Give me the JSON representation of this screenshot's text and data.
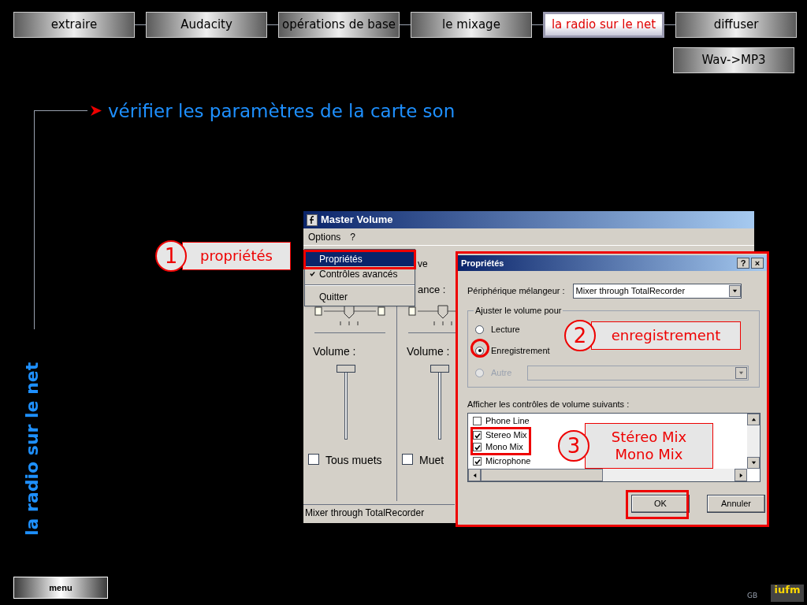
{
  "nav": {
    "tabs": [
      {
        "label": "extraire",
        "selected": false
      },
      {
        "label": "Audacity",
        "selected": false
      },
      {
        "label": "opérations de base",
        "selected": false
      },
      {
        "label": "le mixage",
        "selected": false
      },
      {
        "label": "la radio sur le net",
        "selected": true
      },
      {
        "label": "diffuser",
        "selected": false
      }
    ],
    "sub_tab": "Wav->MP3"
  },
  "heading": "vérifier les paramètres de la carte son",
  "side_title": "la radio sur le net",
  "master_volume": {
    "title": "Master Volume",
    "menu": [
      "Options",
      "?"
    ],
    "dropdown": [
      {
        "kind": "item",
        "label": "Propriétés",
        "selected": true,
        "checked": false
      },
      {
        "kind": "item",
        "label": "Contrôles avancés",
        "selected": false,
        "checked": true
      },
      {
        "kind": "separator"
      },
      {
        "kind": "item",
        "label": "Quitter",
        "selected": false,
        "checked": false
      }
    ],
    "hidden_labels": [
      "ve",
      "ance :"
    ],
    "columns": [
      {
        "label": "Volume :",
        "level": 1,
        "mute_label": "Tous muets",
        "muted": false
      },
      {
        "label": "Volume :",
        "level": 1,
        "mute_label": "Muet",
        "muted": false
      }
    ],
    "status": "Mixer through TotalRecorder"
  },
  "properties": {
    "title": "Propriétés",
    "title_buttons": [
      "?",
      "×"
    ],
    "mixer_label": "Périphérique mélangeur :",
    "mixer_value": "Mixer through TotalRecorder",
    "group_label": "Ajuster le volume pour",
    "radios": [
      {
        "label": "Lecture",
        "selected": false,
        "disabled": false
      },
      {
        "label": "Enregistrement",
        "selected": true,
        "disabled": false
      },
      {
        "label": "Autre",
        "selected": false,
        "disabled": true
      }
    ],
    "list_label": "Afficher les contrôles de volume suivants :",
    "list_items": [
      {
        "label": "Phone Line",
        "checked": false
      },
      {
        "label": "Stereo Mix",
        "checked": true
      },
      {
        "label": "Mono Mix",
        "checked": true
      },
      {
        "label": "Microphone",
        "checked": true
      }
    ],
    "buttons": [
      "OK",
      "Annuler"
    ]
  },
  "callouts": [
    {
      "number": "1",
      "lines": [
        "propriétés"
      ]
    },
    {
      "number": "2",
      "lines": [
        "enregistrement"
      ]
    },
    {
      "number": "3",
      "lines": [
        "Stéreo Mix",
        "Mono Mix"
      ]
    }
  ],
  "menu_button": "menu",
  "footer": "GB",
  "logo": "iufm"
}
